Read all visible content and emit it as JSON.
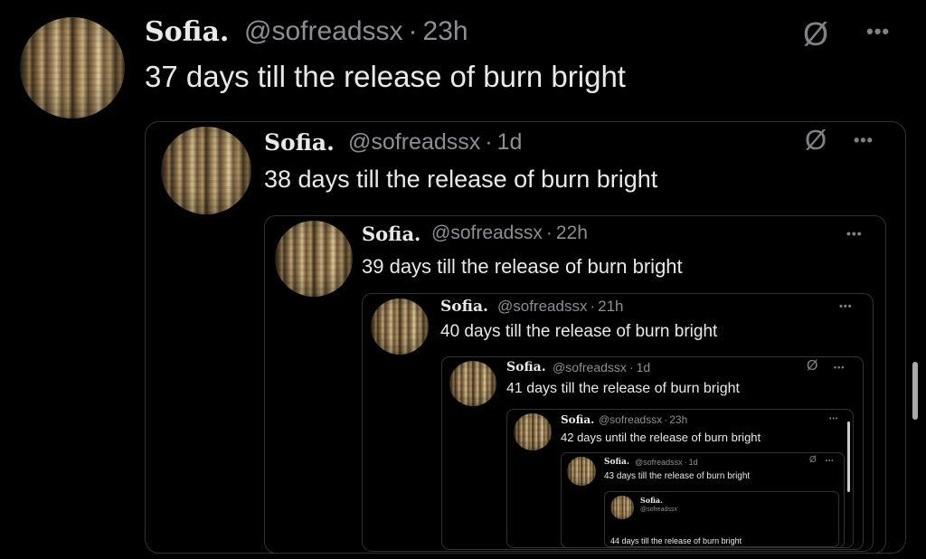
{
  "tweets": [
    {
      "name": "Sofia.",
      "handle": "@sofreadssx",
      "time": "23h",
      "text": "37 days till the release of burn bright"
    },
    {
      "name": "Sofia.",
      "handle": "@sofreadssx",
      "time": "1d",
      "text": "38 days till the release of burn bright"
    },
    {
      "name": "Sofia.",
      "handle": "@sofreadssx",
      "time": "22h",
      "text": "39 days till the release of burn bright"
    },
    {
      "name": "Sofia.",
      "handle": "@sofreadssx",
      "time": "21h",
      "text": "40 days till the release of burn bright"
    },
    {
      "name": "Sofia.",
      "handle": "@sofreadssx",
      "time": "1d",
      "text": "41 days till the release of burn bright"
    },
    {
      "name": "Sofia.",
      "handle": "@sofreadssx",
      "time": "23h",
      "text": "42 days until the release of burn bright"
    },
    {
      "name": "Sofia.",
      "handle": "@sofreadssx",
      "time": "1d",
      "text": "43 days till the release of burn bright"
    },
    {
      "name": "Sofia.",
      "handle": "@sofreadssx",
      "time": "",
      "text": "44 days till the release of burn bright"
    }
  ],
  "separator": "·",
  "more_glyph": "•••",
  "icons": {
    "grok": "grok-slash-icon",
    "more": "more-icon"
  }
}
